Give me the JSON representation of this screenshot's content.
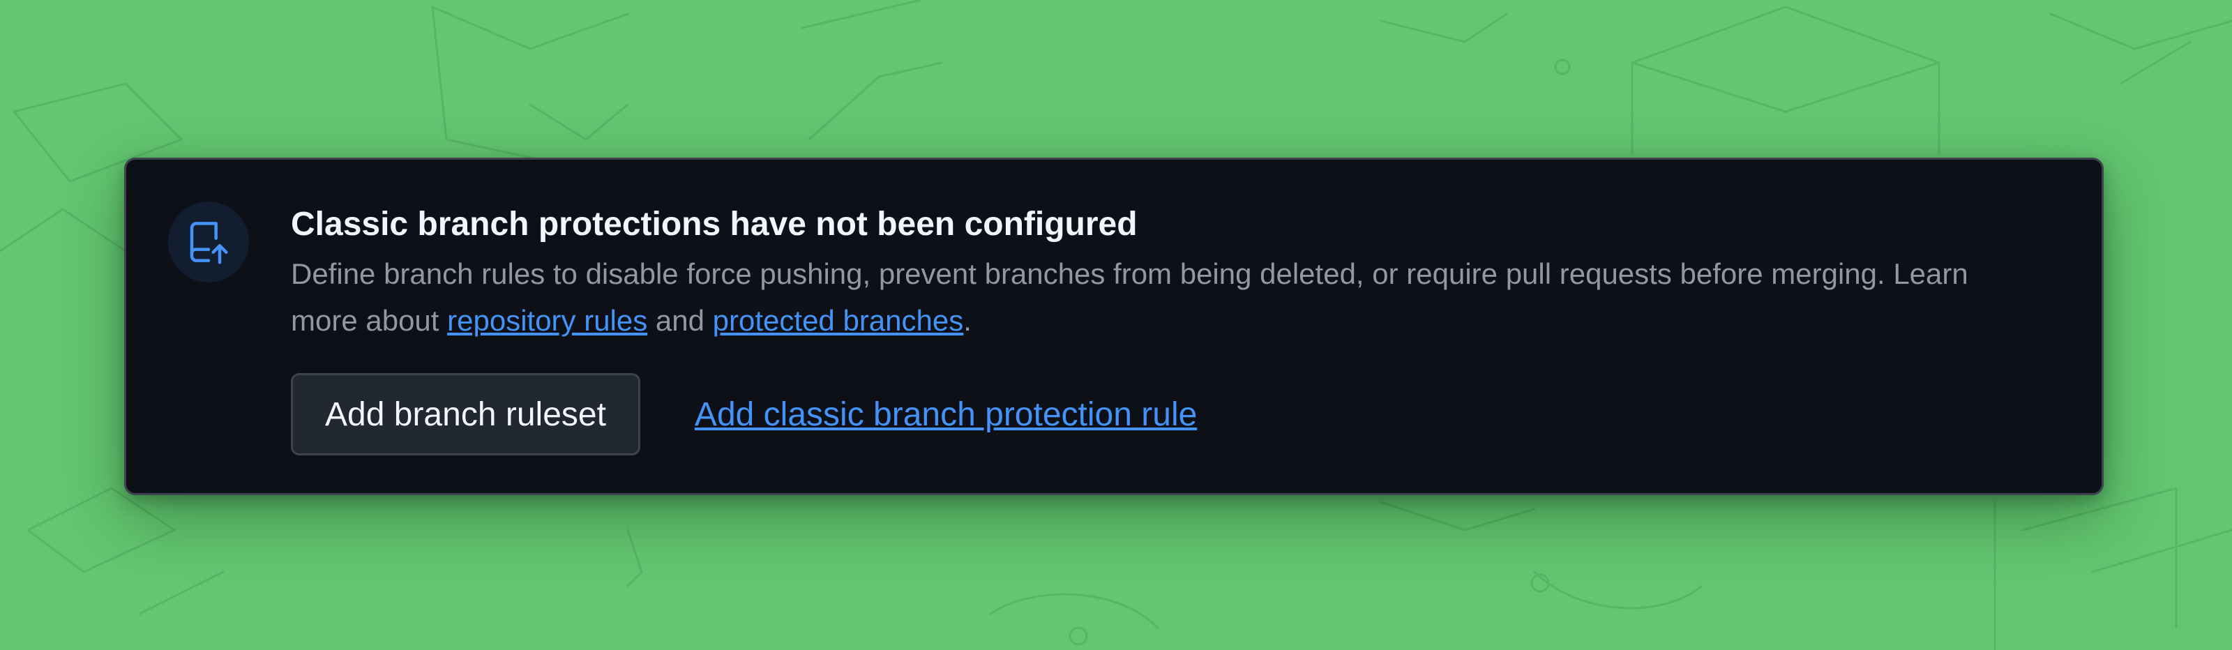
{
  "banner": {
    "title": "Classic branch protections have not been configured",
    "description_prefix": "Define branch rules to disable force pushing, prevent branches from being deleted, or require pull requests before merging. Learn more about ",
    "link_repository_rules": "repository rules",
    "description_joiner": " and ",
    "link_protected_branches": "protected branches",
    "description_suffix": ".",
    "icon": "repo-push-icon",
    "add_ruleset_label": "Add branch ruleset",
    "add_classic_rule_label": "Add classic branch protection rule"
  },
  "colors": {
    "background": "#63c671",
    "card": "#0d1117",
    "link": "#4493f8",
    "title": "#f0f6fc",
    "muted": "#9198a1"
  }
}
